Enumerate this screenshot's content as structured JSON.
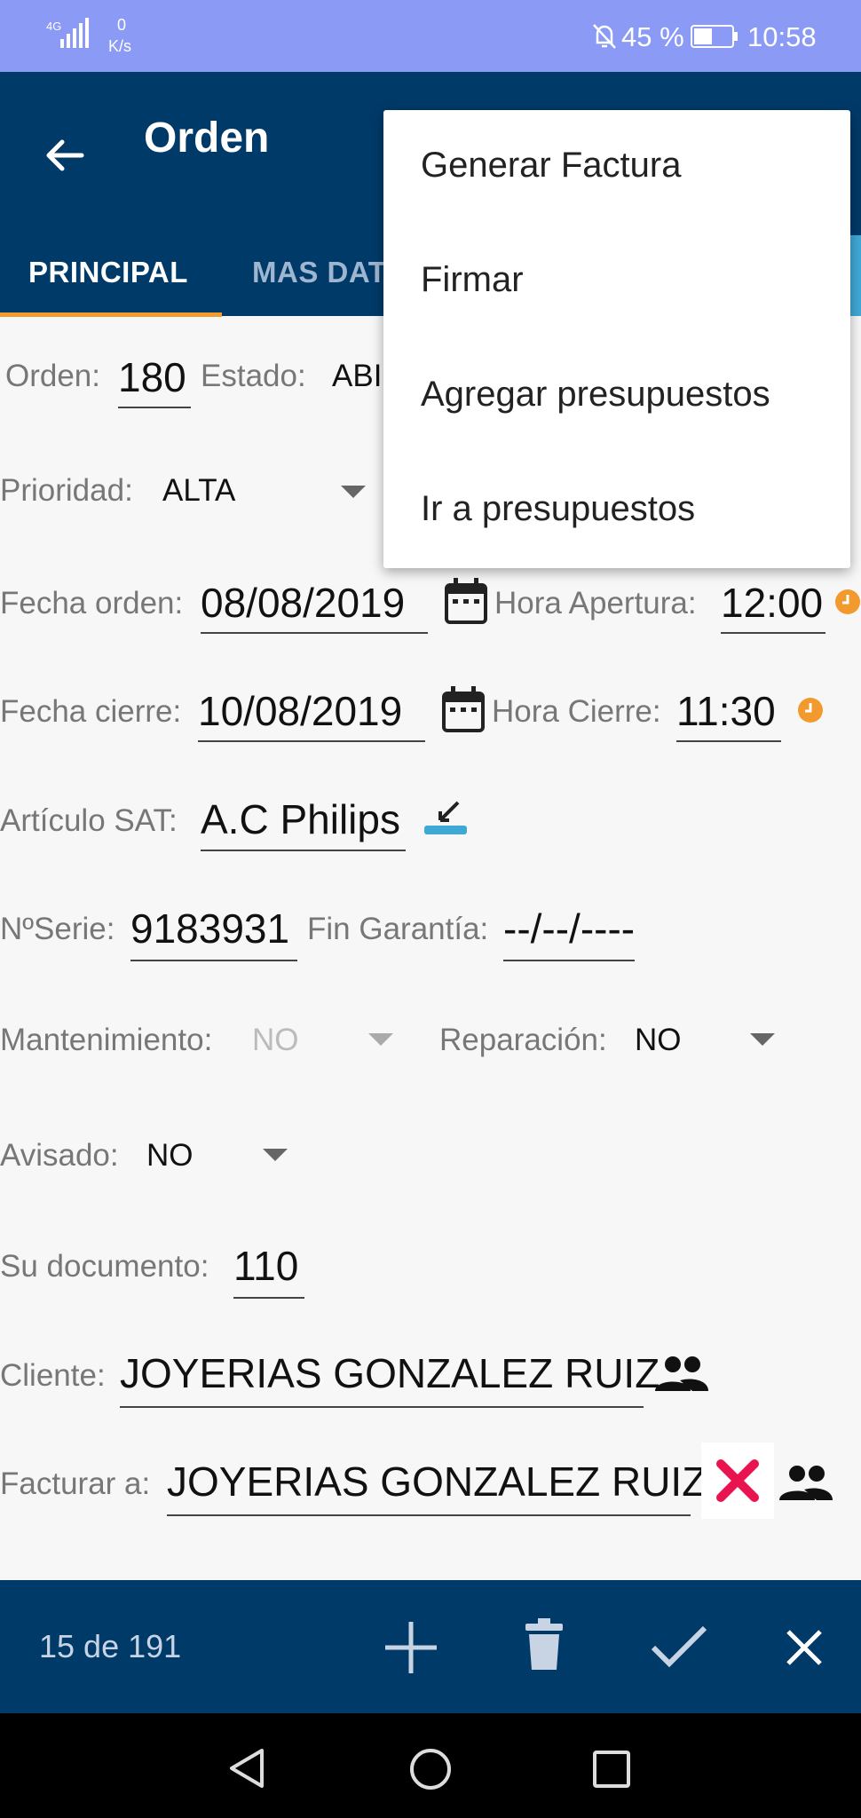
{
  "status_bar": {
    "network": "4G",
    "speed_value": "0",
    "speed_unit": "K/s",
    "battery": "45 %",
    "time": "10:58"
  },
  "header": {
    "title": "Orden"
  },
  "tabs": [
    {
      "label": "PRINCIPAL"
    },
    {
      "label": "MAS DAT"
    }
  ],
  "menu": {
    "items": [
      "Generar Factura",
      "Firmar",
      "Agregar presupuestos",
      "Ir a presupuestos"
    ]
  },
  "form": {
    "orden_label": "Orden:",
    "orden_value": "180",
    "estado_label": "Estado:",
    "estado_value": "ABI",
    "prioridad_label": "Prioridad:",
    "prioridad_value": "ALTA",
    "fecha_orden_label": "Fecha orden:",
    "fecha_orden_value": "08/08/2019",
    "hora_apertura_label": "Hora Apertura:",
    "hora_apertura_value": "12:00",
    "fecha_cierre_label": "Fecha cierre:",
    "fecha_cierre_value": "10/08/2019",
    "hora_cierre_label": "Hora Cierre:",
    "hora_cierre_value": "11:30",
    "articulo_label": "Artículo SAT:",
    "articulo_value": "A.C Philips",
    "serie_label": "NºSerie:",
    "serie_value": "9183931",
    "garantia_label": "Fin Garantía:",
    "garantia_value": "--/--/----",
    "mantenimiento_label": "Mantenimiento:",
    "mantenimiento_value": "NO",
    "reparacion_label": "Reparación:",
    "reparacion_value": "NO",
    "avisado_label": "Avisado:",
    "avisado_value": "NO",
    "documento_label": "Su documento:",
    "documento_value": "110",
    "cliente_label": "Cliente:",
    "cliente_value": "JOYERIAS GONZALEZ RUIZ",
    "facturar_label": "Facturar a:",
    "facturar_value": "JOYERIAS GONZALEZ RUIZ"
  },
  "bottom_bar": {
    "pager": "15 de 191"
  },
  "colors": {
    "primary": "#003a69",
    "status_bar": "#8a9af5",
    "accent": "#f29a2e",
    "clear": "#e8134f"
  },
  "icons": [
    "back-arrow-icon",
    "calendar-icon",
    "clock-icon",
    "article-icon",
    "people-icon",
    "clear-x-icon",
    "add-icon",
    "delete-icon",
    "check-icon",
    "close-icon",
    "nav-back-icon",
    "nav-home-icon",
    "nav-recents-icon"
  ]
}
